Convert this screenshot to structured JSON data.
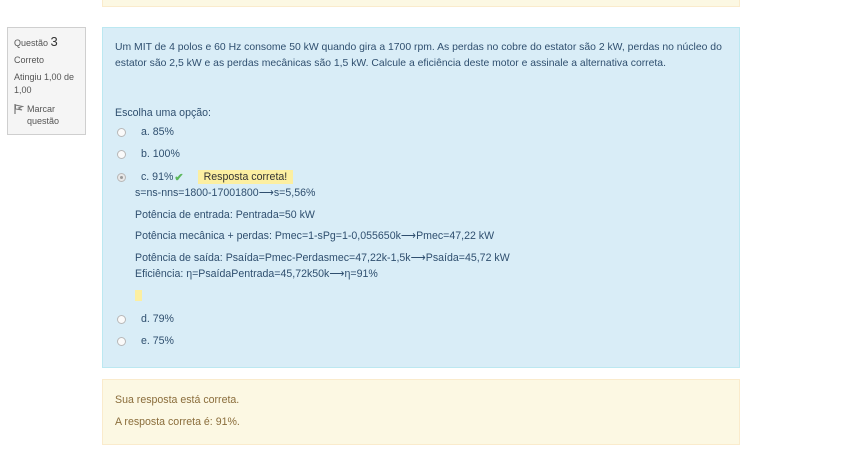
{
  "info": {
    "question_label": "Questão",
    "question_number": "3",
    "state": "Correto",
    "grade": "Atingiu 1,00 de 1,00",
    "flag_label": "Marcar questão"
  },
  "question": {
    "text": "Um MIT de 4 polos e 60 Hz consome 50 kW quando gira a 1700 rpm. As perdas no cobre do estator são 2 kW, perdas no núcleo do estator são 2,5 kW e as perdas mecânicas são 1,5 kW. Calcule a eficiência deste motor e assinale a alternativa correta.",
    "prompt": "Escolha uma opção:",
    "options": [
      {
        "label": "a. 85%"
      },
      {
        "label": "b. 100%"
      },
      {
        "label": "c. 91%"
      },
      {
        "label": "d. 79%"
      },
      {
        "label": "e. 75%"
      }
    ],
    "selected_index": 2,
    "correct_feedback": "Resposta correta!",
    "feedback_lines": [
      "s=ns-nns=1800-17001800⟶s=5,56%",
      "Potência de entrada: Pentrada=50 kW",
      "Potência mecânica + perdas: Pmec=1-sPg=1-0,055650k⟶Pmec=47,22 kW",
      "Potência de saída: Psaída=Pmec-Perdasmec=47,22k-1,5k⟶Psaída=45,72 kW",
      "Eficiência: η=PsaídaPentrada=45,72k50k⟶η=91%"
    ]
  },
  "outcome": {
    "line1": "Sua resposta está correta.",
    "line2": "A resposta correta é: 91%."
  },
  "colors": {
    "formulation_bg": "#d9edf7",
    "outcome_bg": "#fcf8e3",
    "check": "#5cb85c",
    "highlight": "#fcefa1"
  }
}
